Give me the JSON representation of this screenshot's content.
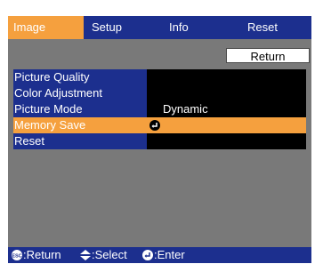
{
  "tabs": [
    {
      "label": "Image",
      "active": true
    },
    {
      "label": "Setup",
      "active": false
    },
    {
      "label": "Info",
      "active": false
    },
    {
      "label": "Reset",
      "active": false
    }
  ],
  "return_label": "Return",
  "menu": {
    "items": [
      {
        "label": "Picture Quality",
        "selected": false
      },
      {
        "label": "Color Adjustment",
        "selected": false
      },
      {
        "label": "Picture Mode",
        "selected": false
      },
      {
        "label": "Memory Save",
        "selected": true
      },
      {
        "label": "Reset",
        "selected": false
      }
    ],
    "picture_mode_value": "Dynamic",
    "memory_save_icon": "enter-icon"
  },
  "footer": {
    "return": ":Return",
    "select": ":Select",
    "enter": ":Enter",
    "esc_icon": "esc-icon",
    "updown_icon": "updown-arrows-icon",
    "enter_icon": "enter-icon"
  },
  "colors": {
    "bar": "#1c2f8e",
    "accent": "#f5a03e",
    "background": "#797979",
    "value_panel": "#000000"
  }
}
